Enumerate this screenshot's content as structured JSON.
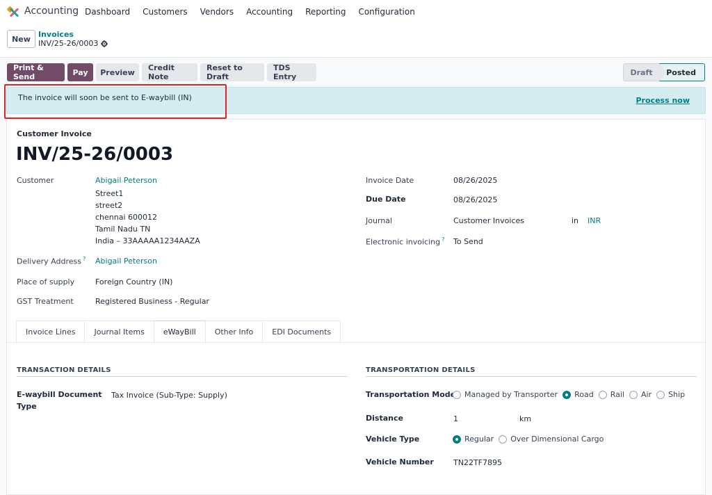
{
  "navbar": {
    "app_name": "Accounting",
    "menu": [
      "Dashboard",
      "Customers",
      "Vendors",
      "Accounting",
      "Reporting",
      "Configuration"
    ]
  },
  "control_panel": {
    "new_label": "New",
    "breadcrumb_parent": "Invoices",
    "breadcrumb_current": "INV/25-26/0003"
  },
  "actions": {
    "print_send": "Print & Send",
    "pay": "Pay",
    "preview": "Preview",
    "credit_note": "Credit Note",
    "reset_to_draft": "Reset to Draft",
    "tds_entry": "TDS Entry"
  },
  "status": {
    "draft": "Draft",
    "posted": "Posted"
  },
  "alert": {
    "message": "The invoice will soon be sent to E-waybill (IN)",
    "action": "Process now"
  },
  "form": {
    "document_type": "Customer Invoice",
    "document_number": "INV/25-26/0003",
    "customer_label": "Customer",
    "customer_name": "Abigail Peterson",
    "address": [
      "Street1",
      "street2",
      "chennai 600012",
      "Tamil Nadu TN",
      "India – 33AAAAA1234AAZA"
    ],
    "delivery_address_label": "Delivery Address",
    "delivery_address": "Abigail Peterson",
    "place_of_supply_label": "Place of supply",
    "place_of_supply": "Foreign Country (IN)",
    "gst_treatment_label": "GST Treatment",
    "gst_treatment": "Registered Business - Regular",
    "invoice_date_label": "Invoice Date",
    "invoice_date": "08/26/2025",
    "due_date_label": "Due Date",
    "due_date": "08/26/2025",
    "journal_label": "Journal",
    "journal": "Customer Invoices",
    "journal_in": "in",
    "currency": "INR",
    "einvoicing_label": "Electronic invoicing",
    "einvoicing": "To Send",
    "help_mark": "?"
  },
  "tabs": [
    "Invoice Lines",
    "Journal Items",
    "eWayBill",
    "Other Info",
    "EDI Documents"
  ],
  "active_tab": "eWayBill",
  "ewaybill": {
    "transaction_title": "TRANSACTION DETAILS",
    "doc_type_label_1": "E-waybill Document",
    "doc_type_label_2": "Type",
    "doc_type_value": "Tax Invoice (Sub-Type: Supply)",
    "transport_title": "TRANSPORTATION DETAILS",
    "mode_label": "Transportation Mode",
    "modes": [
      "Managed by Transporter",
      "Road",
      "Rail",
      "Air",
      "Ship"
    ],
    "mode_selected": "Road",
    "distance_label": "Distance",
    "distance_value": "1",
    "distance_unit": "km",
    "vehicle_type_label": "Vehicle Type",
    "vehicle_types": [
      "Regular",
      "Over Dimensional Cargo"
    ],
    "vehicle_type_selected": "Regular",
    "vehicle_number_label": "Vehicle Number",
    "vehicle_number": "TN22TF7895"
  }
}
